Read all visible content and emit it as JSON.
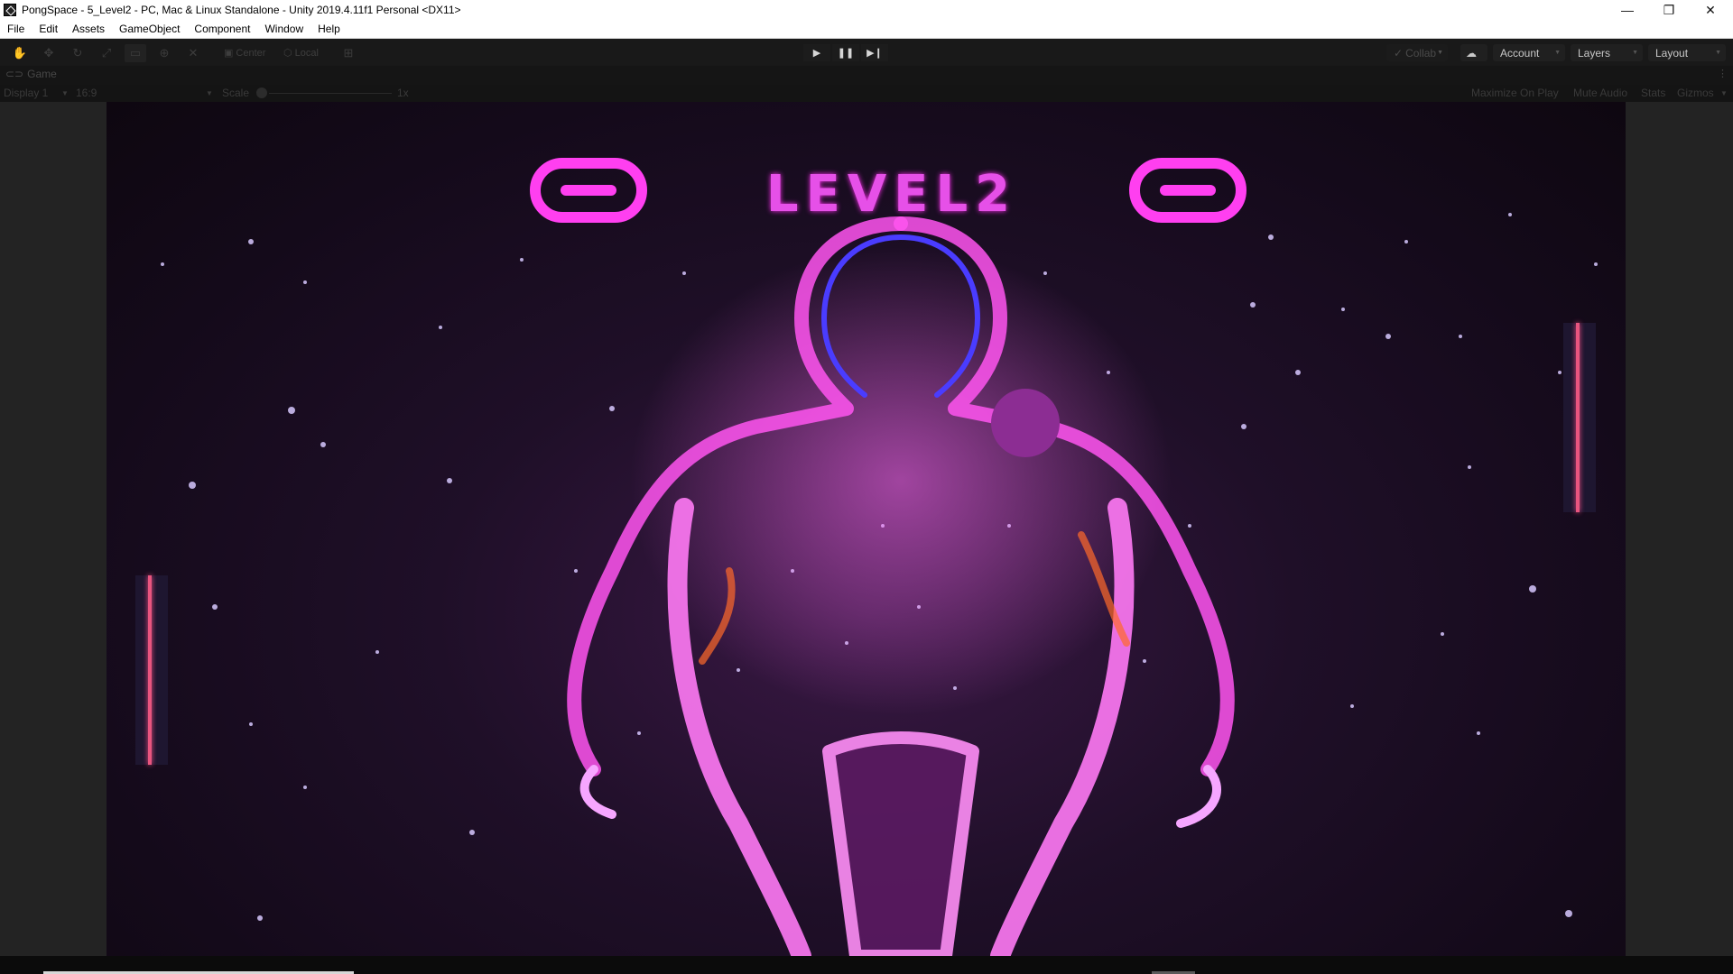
{
  "window": {
    "title": "PongSpace - 5_Level2 - PC, Mac & Linux Standalone - Unity 2019.4.11f1 Personal <DX11>",
    "controls": {
      "minimize": "—",
      "restore": "❐",
      "close": "✕"
    }
  },
  "menu": [
    "File",
    "Edit",
    "Assets",
    "GameObject",
    "Component",
    "Window",
    "Help"
  ],
  "toolbar": {
    "pivot_mode": "Center",
    "pivot_space": "Local",
    "collab_label": "Collab",
    "account_label": "Account",
    "layers_label": "Layers",
    "layout_label": "Layout"
  },
  "game_tab": {
    "label": "Game",
    "display": "Display 1",
    "aspect": "16:9",
    "scale_label": "Scale",
    "scale_value": "1x",
    "maximize_on_play": "Maximize On Play",
    "mute_audio": "Mute Audio",
    "stats": "Stats",
    "gizmos": "Gizmos"
  },
  "game": {
    "level_title": "LEVEL2",
    "score_left": "0",
    "score_right": "0",
    "colors": {
      "accent": "#e650e8",
      "paddle_line": "#e8557f",
      "ball": "#8c2d93"
    }
  }
}
